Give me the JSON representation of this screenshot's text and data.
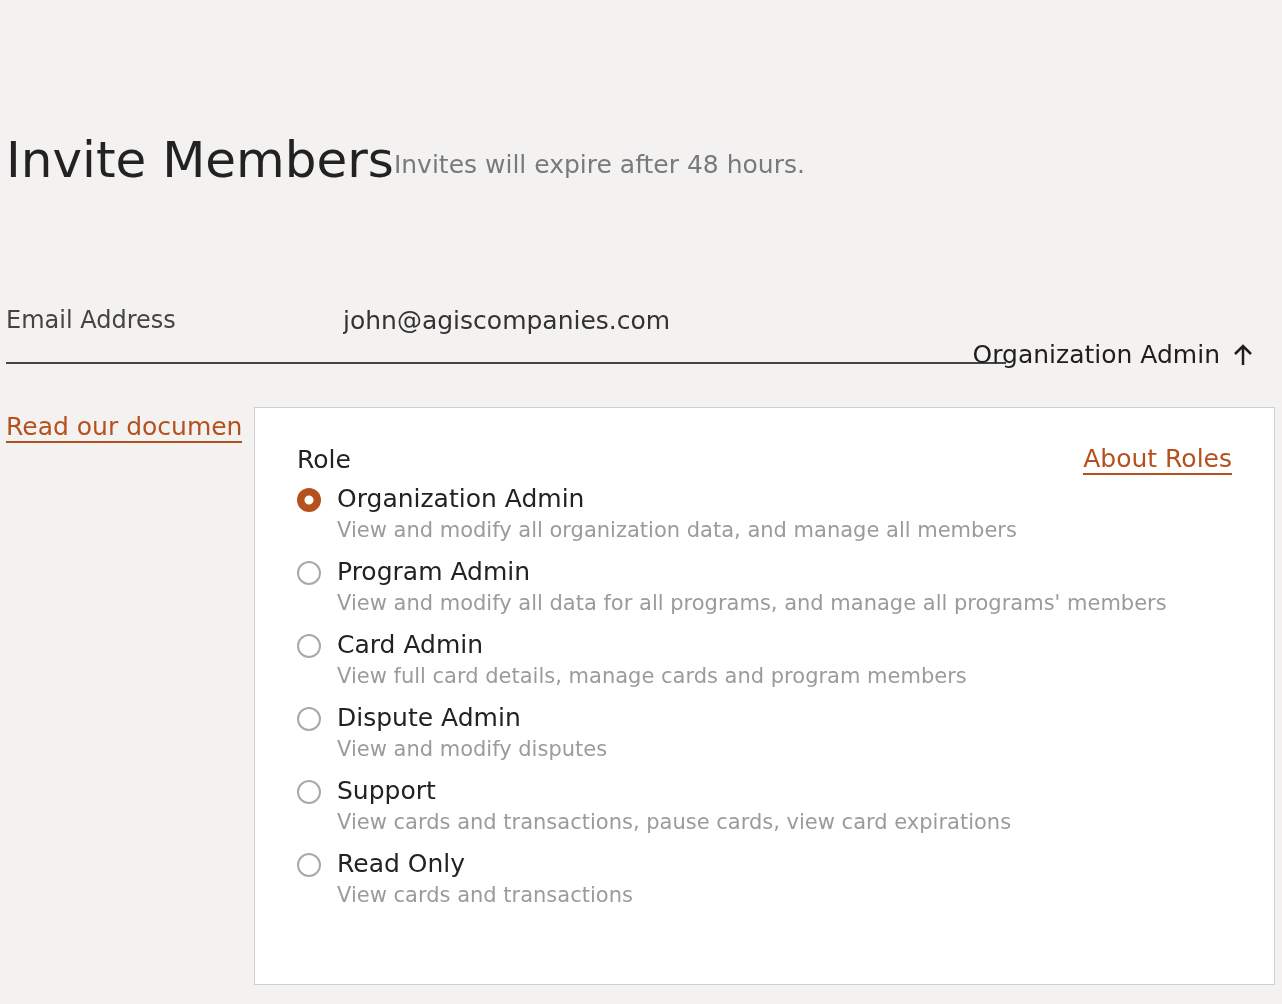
{
  "title": "Invite Members",
  "note": "Invites will expire after 48 hours.",
  "email_row": {
    "label": "Email Address",
    "value": "john@agiscompanies.com",
    "role": "Organization Admin",
    "expanded": true
  },
  "docs_link": "Read our documen",
  "role_menu": {
    "heading": "Role",
    "about_link": "About Roles",
    "options": [
      {
        "name": "Organization Admin",
        "description": "View and modify all organization data, and manage all members",
        "selected": true
      },
      {
        "name": "Program Admin",
        "description": "View and modify all data for all programs, and manage all programs' members",
        "selected": false
      },
      {
        "name": "Card Admin",
        "description": "View full card details, manage cards and program members",
        "selected": false
      },
      {
        "name": "Dispute Admin",
        "description": "View and modify disputes",
        "selected": false
      },
      {
        "name": "Support",
        "description": "View cards and transactions, pause cards, view card expirations",
        "selected": false
      },
      {
        "name": "Read Only",
        "description": "View cards and transactions",
        "selected": false
      }
    ]
  }
}
